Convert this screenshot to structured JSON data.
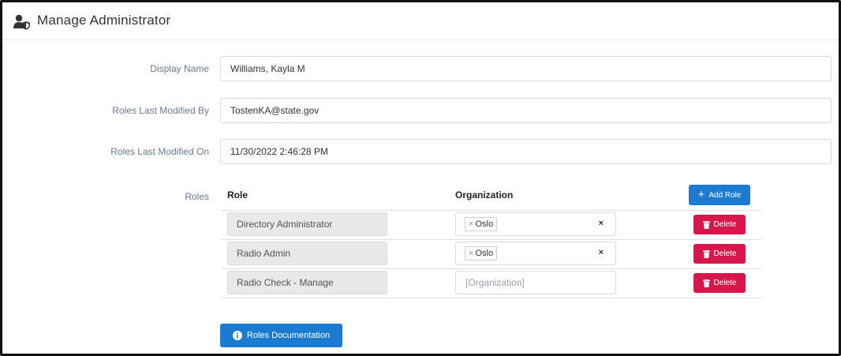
{
  "header": {
    "title": "Manage Administrator",
    "icon": "user-shield-icon"
  },
  "form": {
    "display_name": {
      "label": "Display Name",
      "value": "Williams, Kayla M"
    },
    "roles_last_modified_by": {
      "label": "Roles Last Modified By",
      "value": "TostenKA@state.gov"
    },
    "roles_last_modified_on": {
      "label": "Roles Last Modified On",
      "value": "11/30/2022 2:46:28 PM"
    }
  },
  "roles": {
    "label": "Roles",
    "col_role": "Role",
    "col_org": "Organization",
    "add_button": "Add Role",
    "delete_label": "Delete",
    "org_placeholder": "[Organization]",
    "rows": [
      {
        "role": "Directory Administrator",
        "org_tag": "Oslo"
      },
      {
        "role": "Radio Admin",
        "org_tag": "Oslo"
      },
      {
        "role": "Radio Check - Manage",
        "org_tag": ""
      }
    ]
  },
  "docs_button": "Roles Documentation",
  "colors": {
    "primary": "#1a7bd1",
    "danger": "#d6174c",
    "label": "#6b7a99"
  }
}
